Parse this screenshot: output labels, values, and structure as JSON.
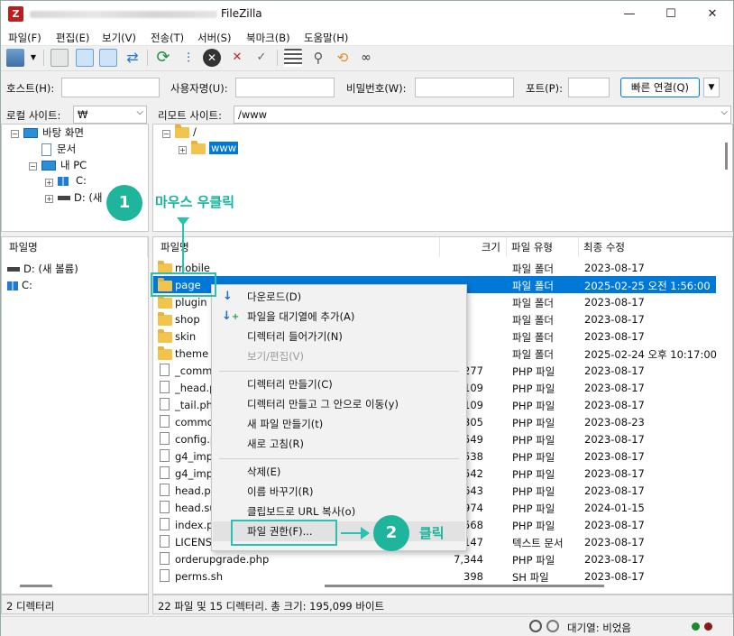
{
  "window": {
    "title": "FileZilla",
    "logo": "Z",
    "minimize_glyph": "—",
    "maximize_glyph": "☐",
    "close_glyph": "✕"
  },
  "menu": [
    "파일(F)",
    "편집(E)",
    "보기(V)",
    "전송(T)",
    "서버(S)",
    "북마크(B)",
    "도움말(H)"
  ],
  "quickconnect": {
    "host_label": "호스트(H):",
    "user_label": "사용자명(U):",
    "pass_label": "비밀번호(W):",
    "port_label": "포트(P):",
    "button_label": "빠른 연결(Q)",
    "dropdown_glyph": "▼"
  },
  "local": {
    "site_label": "로컬 사이트:",
    "site_path": "₩",
    "tree": [
      {
        "label": "바탕 화면",
        "icon": "desktop-icon"
      },
      {
        "label": "문서",
        "icon": "documents-icon"
      },
      {
        "label": "내 PC",
        "icon": "computer-icon"
      },
      {
        "label": "C:",
        "icon": "windows-drive-icon"
      },
      {
        "label": "D: (새",
        "icon": "drive-icon"
      }
    ],
    "list_header": "파일명",
    "list": [
      "D: (새 볼륨)",
      "C:"
    ],
    "status": "2 디렉터리"
  },
  "remote": {
    "site_label": "리모트 사이트:",
    "site_path": "/www",
    "tree": [
      "/",
      "www"
    ],
    "columns": {
      "name": "파일명",
      "size": "크기",
      "type": "파일 유형",
      "modified": "최종 수정"
    },
    "files": [
      {
        "name": "mobile",
        "size": "",
        "type": "파일 폴더",
        "modified": "2023-08-17",
        "kind": "folder"
      },
      {
        "name": "page",
        "size": "",
        "type": "파일 폴더",
        "modified": "2025-02-25 오전 1:56:00",
        "kind": "folder",
        "selected": true
      },
      {
        "name": "plugin",
        "size": "",
        "type": "파일 폴더",
        "modified": "2023-08-17",
        "kind": "folder"
      },
      {
        "name": "shop",
        "size": "",
        "type": "파일 폴더",
        "modified": "2023-08-17",
        "kind": "folder"
      },
      {
        "name": "skin",
        "size": "",
        "type": "파일 폴더",
        "modified": "2023-08-17",
        "kind": "folder"
      },
      {
        "name": "theme",
        "size": "",
        "type": "파일 폴더",
        "modified": "2025-02-24 오후 10:17:00",
        "kind": "folder"
      },
      {
        "name": "_comm",
        "size": "277",
        "type": "PHP 파일",
        "modified": "2023-08-17",
        "kind": "file"
      },
      {
        "name": "_head.p",
        "size": "109",
        "type": "PHP 파일",
        "modified": "2023-08-17",
        "kind": "file"
      },
      {
        "name": "_tail.php",
        "size": "109",
        "type": "PHP 파일",
        "modified": "2023-08-17",
        "kind": "file"
      },
      {
        "name": "commo",
        "size": "35,305",
        "type": "PHP 파일",
        "modified": "2023-08-23",
        "kind": "file"
      },
      {
        "name": "config.p",
        "size": "9,549",
        "type": "PHP 파일",
        "modified": "2023-08-17",
        "kind": "file"
      },
      {
        "name": "g4_impo",
        "size": "2,538",
        "type": "PHP 파일",
        "modified": "2023-08-17",
        "kind": "file"
      },
      {
        "name": "g4_impo",
        "size": "11,542",
        "type": "PHP 파일",
        "modified": "2023-08-17",
        "kind": "file"
      },
      {
        "name": "head.ph",
        "size": "9,643",
        "type": "PHP 파일",
        "modified": "2023-08-17",
        "kind": "file"
      },
      {
        "name": "head.su",
        "size": "4,974",
        "type": "PHP 파일",
        "modified": "2024-01-15",
        "kind": "file"
      },
      {
        "name": "index.ph",
        "size": "2,568",
        "type": "PHP 파일",
        "modified": "2023-08-17",
        "kind": "file"
      },
      {
        "name": "LICENSE.",
        "size": "63,147",
        "type": "텍스트 문서",
        "modified": "2023-08-17",
        "kind": "file"
      },
      {
        "name": "orderupgrade.php",
        "size": "7,344",
        "type": "PHP 파일",
        "modified": "2023-08-17",
        "kind": "file"
      },
      {
        "name": "perms.sh",
        "size": "398",
        "type": "SH 파일",
        "modified": "2023-08-17",
        "kind": "file"
      }
    ],
    "status": "22 파일 및 15 디렉터리. 총 크기: 195,099 바이트"
  },
  "context_menu": {
    "items": [
      {
        "label": "다운로드(D)",
        "icon": "download-arrow-icon",
        "disabled": false
      },
      {
        "label": "파일을 대기열에 추가(A)",
        "icon": "add-queue-icon",
        "disabled": false
      },
      {
        "label": "디렉터리 들어가기(N)",
        "icon": "",
        "disabled": false
      },
      {
        "label": "보기/편집(V)",
        "icon": "",
        "disabled": true
      },
      {
        "label": "디렉터리 만들기(C)",
        "icon": "",
        "disabled": false
      },
      {
        "label": "디렉터리 만들고 그 안으로 이동(y)",
        "icon": "",
        "disabled": false
      },
      {
        "label": "새 파일 만들기(t)",
        "icon": "",
        "disabled": false
      },
      {
        "label": "새로 고침(R)",
        "icon": "",
        "disabled": false
      },
      {
        "label": "삭제(E)",
        "icon": "",
        "disabled": false
      },
      {
        "label": "이름 바꾸기(R)",
        "icon": "",
        "disabled": false
      },
      {
        "label": "클립보드로 URL 복사(o)",
        "icon": "",
        "disabled": false
      },
      {
        "label": "파일 권한(F)...",
        "icon": "",
        "disabled": false
      }
    ]
  },
  "annotations": {
    "step1_number": "1",
    "step1_text": "마우스 우클릭",
    "step2_number": "2",
    "step2_text": "클릭",
    "accent_color": "#1fb49c"
  },
  "statusbar": {
    "queue_label": "대기열: 비었음"
  },
  "colors": {
    "selection": "#0078d7",
    "folder": "#f3c44d",
    "annotation": "#1fb49c"
  }
}
